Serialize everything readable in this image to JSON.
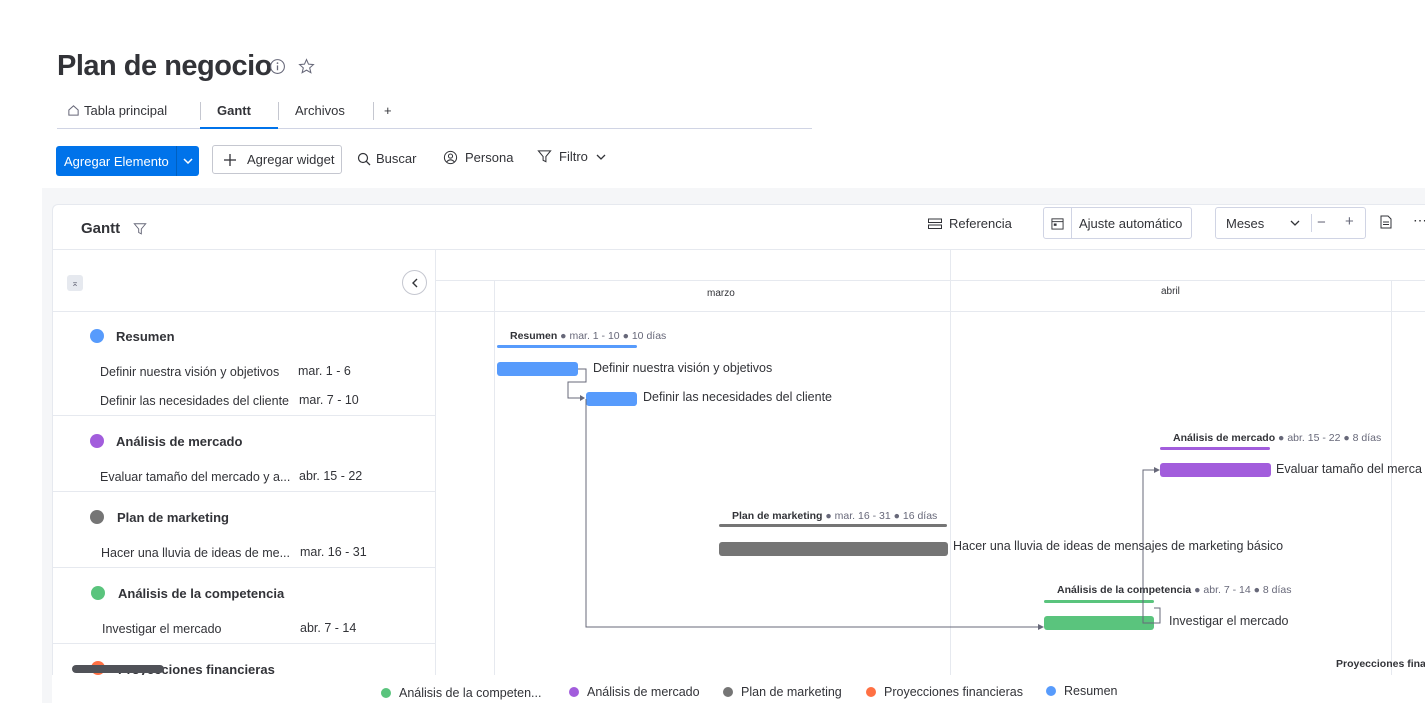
{
  "board": {
    "title": "Plan de negocio",
    "tabs": [
      {
        "label": "Tabla principal"
      },
      {
        "label": "Gantt"
      },
      {
        "label": "Archivos"
      },
      {
        "label": "+"
      }
    ]
  },
  "toolbar": {
    "add_item": "Agregar Elemento",
    "add_widget": "Agregar widget",
    "search": "Buscar",
    "person": "Persona",
    "filter": "Filtro"
  },
  "gantt": {
    "title": "Gantt",
    "reference": "Referencia",
    "autofit": "Ajuste automático",
    "scale": "Meses",
    "months": [
      "marzo",
      "abril"
    ]
  },
  "groups": [
    {
      "name": "Resumen",
      "color": "#579bfc",
      "items": [
        {
          "name": "Definir nuestra visión y objetivos",
          "dates": "mar. 1 - 6"
        },
        {
          "name": "Definir las necesidades del cliente",
          "dates": "mar. 7 - 10"
        }
      ],
      "summary": {
        "dates": "mar. 1 - 10",
        "days": "10 días"
      }
    },
    {
      "name": "Análisis de mercado",
      "color": "#a25ddc",
      "items": [
        {
          "name": "Evaluar tamaño del mercado y a...",
          "bar_label": "Evaluar tamaño del merca",
          "dates": "abr. 15 - 22"
        }
      ],
      "summary": {
        "dates": "abr. 15 - 22",
        "days": "8 días"
      }
    },
    {
      "name": "Plan de marketing",
      "color": "#757575",
      "items": [
        {
          "name": "Hacer una lluvia de ideas de me...",
          "bar_label": "Hacer una lluvia de ideas de mensajes de marketing básico",
          "dates": "mar. 16 - 31"
        }
      ],
      "summary": {
        "dates": "mar. 16 - 31",
        "days": "16 días"
      }
    },
    {
      "name": "Análisis de la competencia",
      "color": "#5ac47d",
      "items": [
        {
          "name": "Investigar el mercado",
          "dates": "abr. 7 - 14"
        }
      ],
      "summary": {
        "dates": "abr. 7 - 14",
        "days": "8 días"
      }
    },
    {
      "name": "Proyecciones financieras",
      "color": "#ff7043",
      "summary_cut": "Proyecciones fina"
    }
  ],
  "legend": [
    {
      "label": "Análisis de la competen...",
      "color": "#5ac47d"
    },
    {
      "label": "Análisis de mercado",
      "color": "#a25ddc"
    },
    {
      "label": "Plan de marketing",
      "color": "#757575"
    },
    {
      "label": "Proyecciones financieras",
      "color": "#ff7043"
    },
    {
      "label": "Resumen",
      "color": "#579bfc"
    }
  ]
}
